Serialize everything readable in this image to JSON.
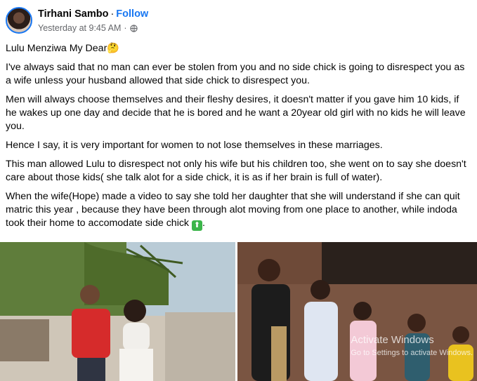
{
  "header": {
    "author": "Tirhani Sambo",
    "separator": "·",
    "follow_label": "Follow",
    "timestamp": "Yesterday at 9:45 AM",
    "meta_separator": "·",
    "audience_icon": "globe-icon",
    "more_label": "···"
  },
  "post": {
    "paragraphs": [
      "Lulu Menziwa My Dear🤔",
      "I've always said that no man can ever be stolen from you and no side chick is going to disrespect you as a wife unless your husband allowed that side chick to disrespect you.",
      "Men will always choose themselves and their fleshy desires, it doesn't matter if you gave him 10 kids, if he wakes up one day and decide that he is bored and he want a 20year old girl  with no kids he will leave you.",
      "Hence I say, it is very important for women to not lose themselves in these marriages.",
      "This man allowed Lulu to disrespect not only his wife but his children too, she went on to say she doesn't care about those kids( she talk alot for a side chick, it is as if her brain is full of water).",
      "When the wife(Hope) made a video to say she told her daughter that she will understand if she can quit matric this year , because they have been through alot moving from one place to another, while indoda took their home to accomodate side chick"
    ],
    "trailing_emoji": "⬆",
    "trailing_period": "."
  },
  "photos": {
    "watermark_line1": "Activate Windows",
    "watermark_line2": "Go to Settings to activate Windows."
  },
  "colors": {
    "accent": "#1877f2",
    "muted": "#65676b",
    "text": "#050505"
  }
}
